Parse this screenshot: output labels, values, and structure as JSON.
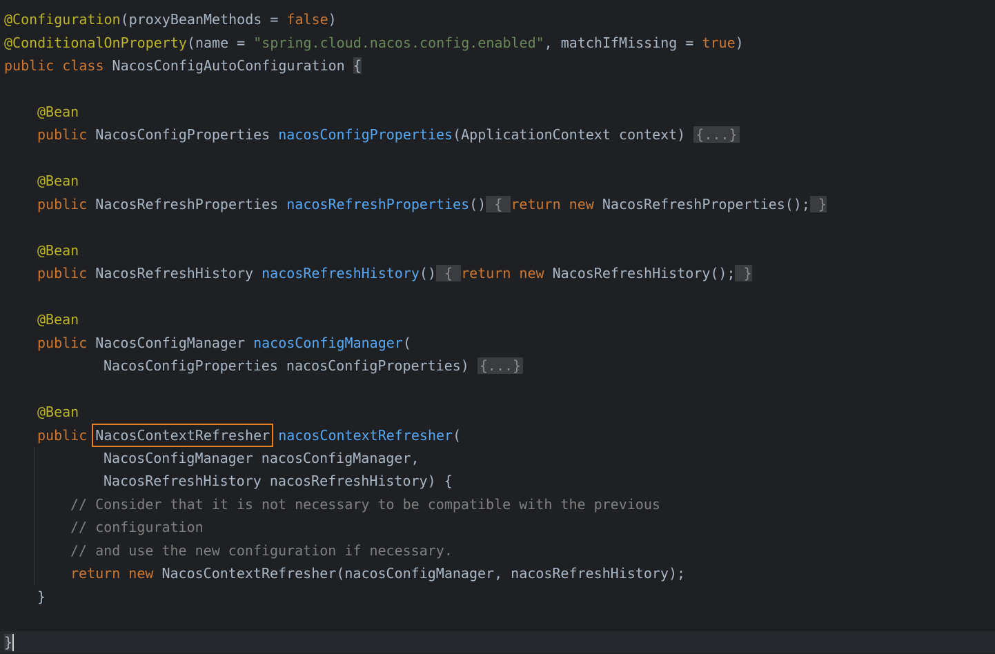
{
  "colors": {
    "background": "#1f2023",
    "annotation": "#bbb529",
    "keyword": "#cc7832",
    "string": "#6a8759",
    "method": "#56a8f5",
    "identifier": "#a9b7c6",
    "comment": "#808080",
    "highlight_box": "#e8811f"
  },
  "code": {
    "l1": {
      "a": "@Configuration",
      "b": "(proxyBeanMethods = ",
      "c": "false",
      "d": ")"
    },
    "l2": {
      "a": "@ConditionalOnProperty",
      "b": "(name = ",
      "c": "\"spring.cloud.nacos.config.enabled\"",
      "d": ", matchIfMissing = ",
      "e": "true",
      "f": ")"
    },
    "l3": {
      "a": "public class ",
      "b": "NacosConfigAutoConfiguration ",
      "c": "{"
    },
    "l4": {
      "a": "@Bean"
    },
    "l5": {
      "a": "public ",
      "b": "NacosConfigProperties ",
      "c": "nacosConfigProperties",
      "d": "(ApplicationContext context) ",
      "e": "{...}"
    },
    "l6": {
      "a": "@Bean"
    },
    "l7": {
      "a": "public ",
      "b": "NacosRefreshProperties ",
      "c": "nacosRefreshProperties",
      "d": "()",
      "e": " { ",
      "f": "return new ",
      "g": "NacosRefreshProperties();",
      "h": " }"
    },
    "l8": {
      "a": "@Bean"
    },
    "l9": {
      "a": "public ",
      "b": "NacosRefreshHistory ",
      "c": "nacosRefreshHistory",
      "d": "()",
      "e": " { ",
      "f": "return new ",
      "g": "NacosRefreshHistory();",
      "h": " }"
    },
    "l10": {
      "a": "@Bean"
    },
    "l11": {
      "a": "public ",
      "b": "NacosConfigManager ",
      "c": "nacosConfigManager",
      "d": "("
    },
    "l12": {
      "a": "NacosConfigProperties nacosConfigProperties) ",
      "b": "{...}"
    },
    "l13": {
      "a": "@Bean"
    },
    "l14": {
      "a": "public ",
      "b": "NacosContextRefresher",
      "c": "nacosContextRefresher",
      "d": "("
    },
    "l15": {
      "a": "NacosConfigManager nacosConfigManager,"
    },
    "l16": {
      "a": "NacosRefreshHistory nacosRefreshHistory) {"
    },
    "l17": {
      "a": "// Consider that it is not necessary to be compatible with the previous"
    },
    "l18": {
      "a": "// configuration"
    },
    "l19": {
      "a": "// and use the new configuration if necessary."
    },
    "l20": {
      "a": "return new ",
      "b": "NacosContextRefresher(nacosConfigManager, nacosRefreshHistory);"
    },
    "l21": {
      "a": "}"
    },
    "l22": {
      "a": "}"
    }
  }
}
